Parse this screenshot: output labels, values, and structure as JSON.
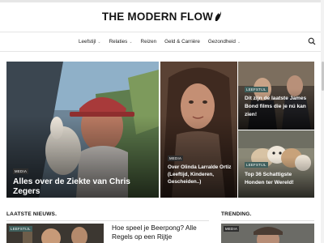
{
  "site": {
    "logo_text": "THE MODERN FLOW"
  },
  "nav": {
    "items": [
      {
        "label": "Leefstijl",
        "has_dropdown": true
      },
      {
        "label": "Relaties",
        "has_dropdown": true
      },
      {
        "label": "Reizen",
        "has_dropdown": false
      },
      {
        "label": "Geld & Carrière",
        "has_dropdown": false
      },
      {
        "label": "Gezondheid",
        "has_dropdown": true
      }
    ],
    "search_icon": "search-icon"
  },
  "featured": [
    {
      "category": "MEDIA",
      "title": "Alles over de Ziekte van Chris Zegers"
    },
    {
      "category": "MEDIA",
      "title": "Over Olinda Larralde Ortiz (Leeftijd, Kinderen, Gescheiden..)"
    },
    {
      "category": "LEEFSTIJL",
      "title": "Dit zijn de laatste James Bond films die je nú kan zien!"
    },
    {
      "category": "LEEFSTIJL",
      "title": "Top 36 Schattigste Honden ter Wereld!"
    }
  ],
  "latest": {
    "heading": "LAATSTE NIEUWS.",
    "item": {
      "category": "LEEFSTIJL",
      "title": "Hoe speel je Beerpong? Alle Regels op een Rijtje"
    }
  },
  "trending": {
    "heading": "TRENDING.",
    "item": {
      "category": "MEDIA"
    }
  },
  "colors": {
    "badge_dark": "#2e2e2e",
    "badge_teal": "#3f5f5c",
    "text": "#111111"
  }
}
